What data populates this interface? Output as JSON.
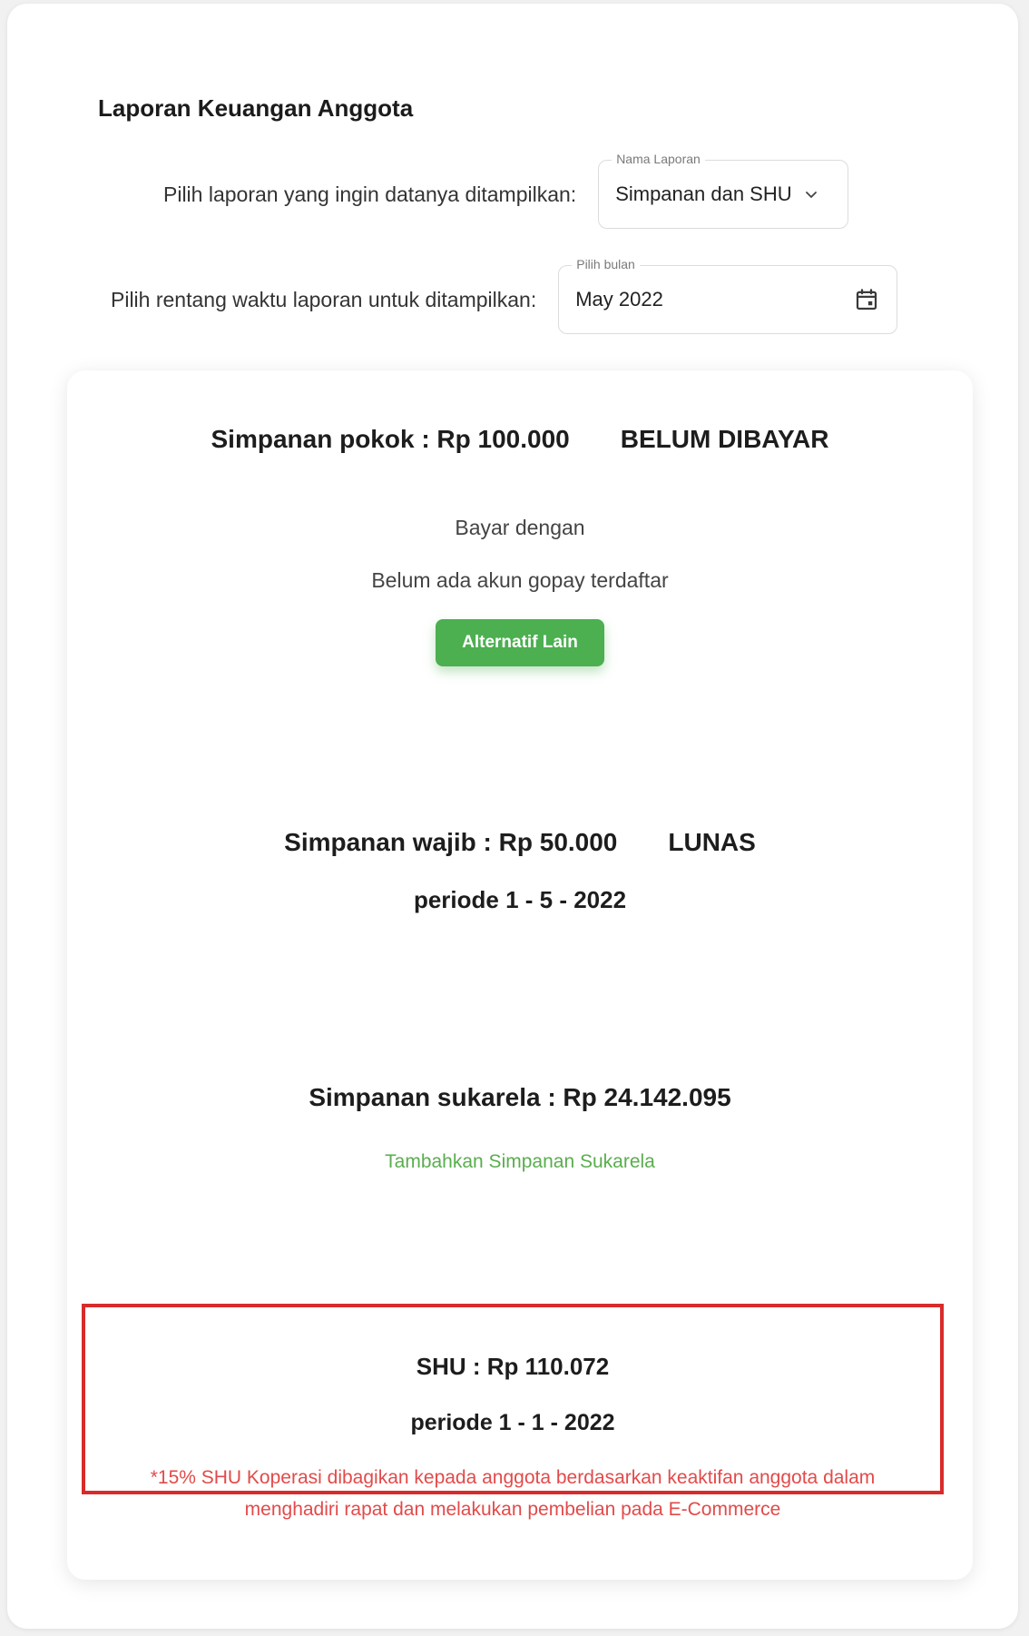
{
  "page": {
    "title": "Laporan Keuangan Anggota"
  },
  "report_select": {
    "label": "Pilih laporan yang ingin datanya ditampilkan:",
    "legend": "Nama Laporan",
    "value": "Simpanan dan SHU",
    "icon": "chevron-down-icon"
  },
  "period_select": {
    "label": "Pilih rentang waktu laporan untuk ditampilkan:",
    "legend": "Pilih bulan",
    "value": "May 2022",
    "icon": "calendar-icon"
  },
  "simpanan_pokok": {
    "text": "Simpanan pokok : Rp 100.000",
    "status": "BELUM DIBAYAR",
    "pay_with": "Bayar dengan",
    "no_account": "Belum ada akun gopay terdaftar",
    "alt_button": "Alternatif Lain"
  },
  "simpanan_wajib": {
    "text": "Simpanan wajib : Rp 50.000",
    "status": "LUNAS",
    "period": "periode 1 - 5 - 2022"
  },
  "simpanan_sukarela": {
    "text": "Simpanan sukarela : Rp 24.142.095",
    "add_link": "Tambahkan Simpanan Sukarela"
  },
  "shu": {
    "text": "SHU : Rp 110.072",
    "period": "periode 1 - 1 - 2022",
    "note": "*15% SHU Koperasi dibagikan kepada anggota berdasarkan keaktifan anggota dalam menghadiri rapat dan melakukan pembelian pada E-Commerce"
  },
  "colors": {
    "accent_green": "#4caf50",
    "link_green": "#5aad4e",
    "highlight_red": "#d92b2b",
    "note_red": "#e24a4a"
  }
}
